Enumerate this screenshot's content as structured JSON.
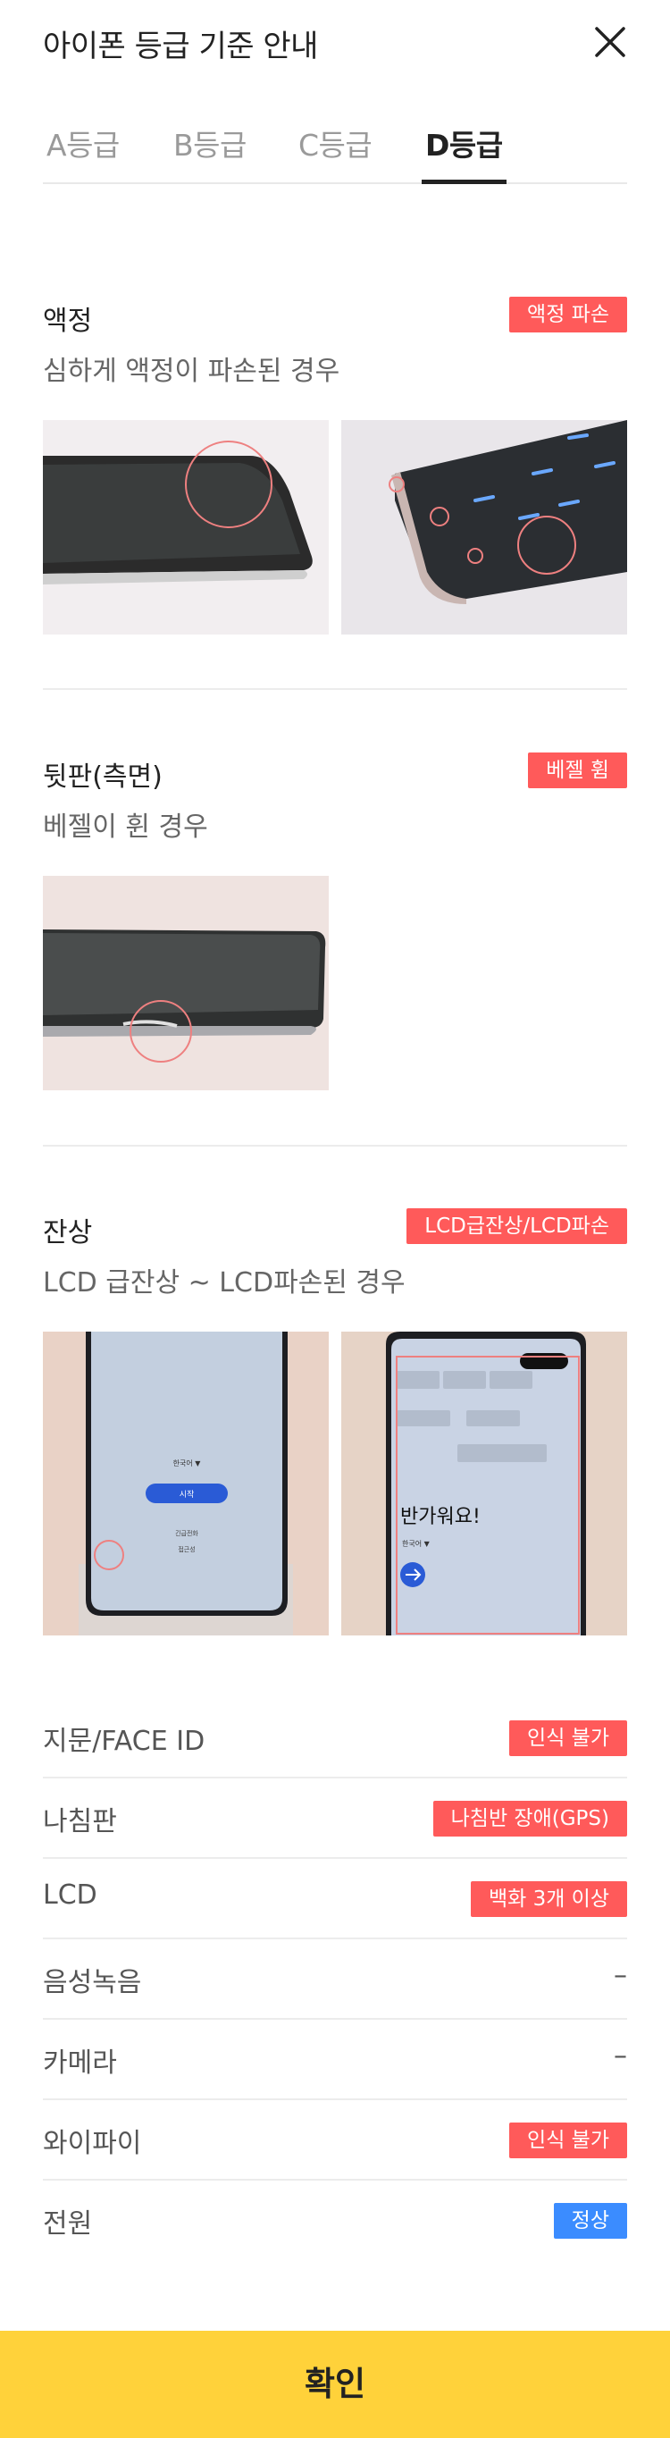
{
  "header": {
    "title": "아이폰 등급 기준 안내"
  },
  "tabs": [
    {
      "label": "A등급"
    },
    {
      "label": "B등급"
    },
    {
      "label": "C등급"
    },
    {
      "label": "D등급"
    }
  ],
  "sections": [
    {
      "title": "액정",
      "subtitle": "심하게 액정이 파손된 경우",
      "tag": "액정 파손"
    },
    {
      "title": "뒷판(측면)",
      "subtitle": "베젤이 휜 경우",
      "tag": "베젤 휨"
    },
    {
      "title": "잔상",
      "subtitle": "LCD 급잔상 ~ LCD파손된 경우",
      "tag": "LCD급잔상/LCD파손"
    }
  ],
  "afterimage_photo_1": {
    "language": "한국어 ▼",
    "start": "시작",
    "emergency": "긴급전화",
    "accessibility": "접근성"
  },
  "afterimage_photo_2": {
    "greeting": "반가워요!",
    "language": "한국어 ▼"
  },
  "specs": [
    {
      "label": "지문/FACE ID",
      "value": "인식 불가",
      "style": "red"
    },
    {
      "label": "나침판",
      "value": "나침반 장애(GPS)",
      "style": "red"
    },
    {
      "label": "LCD",
      "value": "백화 3개 이상",
      "style": "red"
    },
    {
      "label": "음성녹음",
      "value": "–",
      "style": "dash"
    },
    {
      "label": "카메라",
      "value": "–",
      "style": "dash"
    },
    {
      "label": "와이파이",
      "value": "인식 불가",
      "style": "red"
    },
    {
      "label": "전원",
      "value": "정상",
      "style": "blue"
    }
  ],
  "footer": {
    "confirm_label": "확인"
  },
  "colors": {
    "tag_red": "#ff5a5a",
    "tag_blue": "#3b8cff",
    "confirm_yellow": "#ffd23a"
  }
}
